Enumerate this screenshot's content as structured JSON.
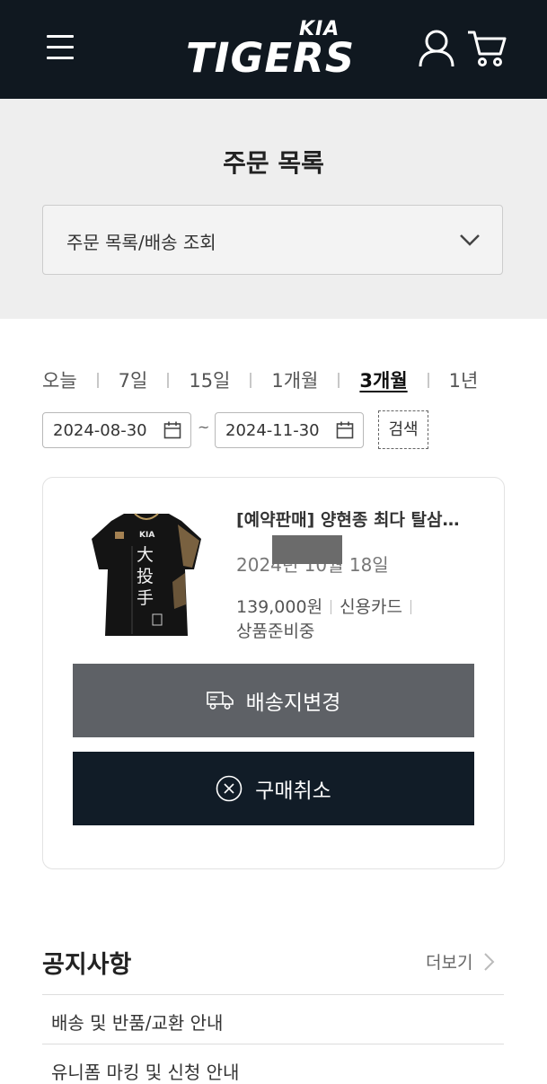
{
  "header": {
    "brand_top": "KIA",
    "brand_name": "TIGERS",
    "menu_icon": "hamburger-menu-icon",
    "user_icon": "user-icon",
    "cart_icon": "cart-icon"
  },
  "page": {
    "title": "주문 목록",
    "dropdown_value": "주문 목록/배송 조회"
  },
  "period_tabs": [
    {
      "label": "오늘",
      "active": false
    },
    {
      "label": "7일",
      "active": false
    },
    {
      "label": "15일",
      "active": false
    },
    {
      "label": "1개월",
      "active": false
    },
    {
      "label": "3개월",
      "active": true
    },
    {
      "label": "1년",
      "active": false
    }
  ],
  "date_range": {
    "start": "2024-08-30",
    "separator": "~",
    "end": "2024-11-30",
    "search_label": "검색"
  },
  "order": {
    "product_name": "[예약판매] 양현종 최다 탈삼진 기록 유니폼",
    "order_date": "2024년 10월 18일",
    "price": "139,000원",
    "payment_method": "신용카드",
    "status": "상품준비중",
    "change_address_label": "배송지변경",
    "cancel_label": "구매취소"
  },
  "notice": {
    "title": "공지사항",
    "more_label": "더보기",
    "items": [
      "배송 및 반품/교환 안내",
      "유니폼 마킹 및 신청 안내"
    ]
  },
  "colors": {
    "header_bg": "#101820",
    "title_section_bg": "#eeeeee",
    "address_button_bg": "#5e6166",
    "cancel_button_bg": "#111c27"
  }
}
